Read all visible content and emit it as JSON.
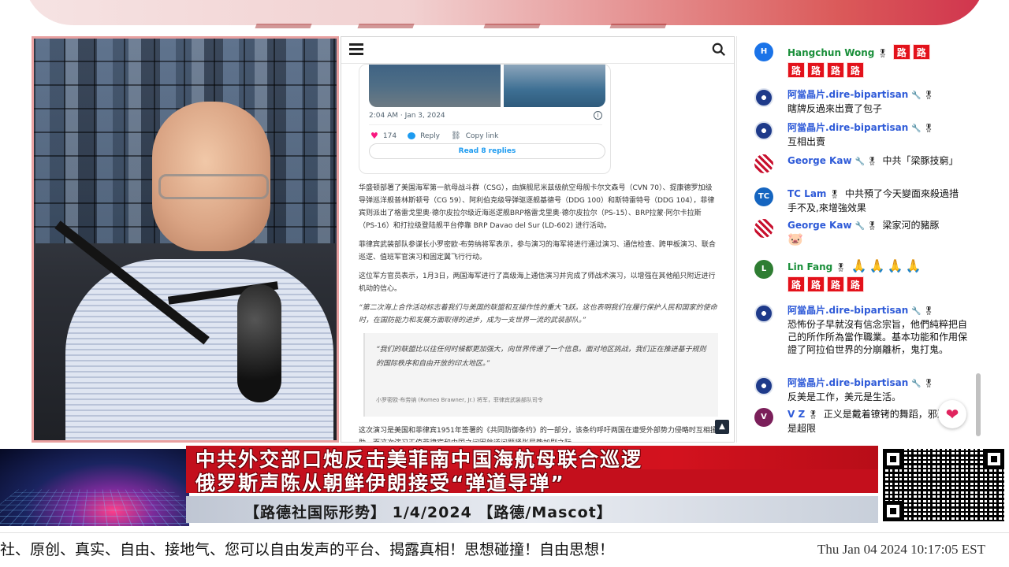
{
  "article": {
    "tweet": {
      "time": "2:04 AM · Jan 3, 2024",
      "likes": "174",
      "reply_label": "Reply",
      "copy_link_label": "Copy link",
      "read_replies_label": "Read 8 replies"
    },
    "paragraphs": [
      "华盛顿部署了美国海军第一航母战斗群（CSG），由旗舰尼米兹级航空母舰卡尔文森号（CVN 70）、提康德罗加级导弹巡洋舰普林斯顿号（CG 59）、阿利伯克级导弹驱逐舰基德号（DDG 100）和斯特雷特号（DDG 104），菲律宾则派出了格雷戈里奥·德尔皮拉尔级近海巡逻舰BRP格雷戈里奥·德尔皮拉尔（PS-15）、BRP拉蒙·阿尔卡拉斯（PS-16）和打拉级登陆舰平台停靠 BRP Davao del Sur (LD-602) 进行活动。",
      "菲律宾武装部队参谋长小罗密欧·布劳纳将军表示，参与演习的海军将进行通过演习、通信检查、跨甲板演习、联合巡逻、值班军官演习和固定翼飞行行动。",
      "这位军方官员表示，1月3日，两国海军进行了高级海上通信演习并完成了师战术演习，以增强在其他船只附近进行机动的信心。"
    ],
    "quote_paragraph": "“第二次海上合作活动标志着我们与美国的联盟和互操作性的重大飞跃。这也表明我们在履行保护人民和国家的使命时，在国防能力和发展方面取得的进步，成为一支世界一流的武装部队。”",
    "blockquote": {
      "text": "“我们的联盟比以往任何时候都更加强大，向世界传递了一个信息。面对地区挑战，我们正在推进基于规则的国际秩序和自由开放的印太地区。”",
      "credit": "小罗密欧·布劳纳 (Romeo Brawner, Jr.) 将军，菲律宾武装部队司令"
    },
    "closing_paragraph": "这次演习是美国和菲律宾1951年签署的《共同防御条约》的一部分，该条约呼吁两国在遭受外部势力侵略时互相援助，而这次演习正值菲律宾和中国之间因航道问题紧张局势加剧之际。"
  },
  "chat": {
    "messages": [
      {
        "author": "Hangchun Wong",
        "text": "",
        "lu_count": 6
      },
      {
        "author": "阿當晶片.dire-bipartisan",
        "text": "瞎牌反過來出賣了包子"
      },
      {
        "author": "阿當晶片.dire-bipartisan",
        "text": "互相出賣"
      },
      {
        "author": "George Kaw",
        "text": "中共「梁豚技窮」"
      },
      {
        "author": "TC Lam",
        "text": "中共預了今天變面來殺過措手不及,來增強效果"
      },
      {
        "author": "George Kaw",
        "text": "梁家河的豬豚"
      },
      {
        "author": "Lin Fang",
        "text": "",
        "lu_count": 4
      },
      {
        "author": "阿當晶片.dire-bipartisan",
        "text": "恐怖份子早就沒有信念宗旨，他們純粹把自己的所作所為當作職業。基本功能和作用保證了阿拉伯世界的分崩離析，鬼打鬼。"
      },
      {
        "author": "阿當晶片.dire-bipartisan",
        "text": "反美是工作，美元是生活。"
      },
      {
        "author": "V Z",
        "text": "正义是戴着镣铐的舞蹈，邪恶靠的是超限"
      }
    ],
    "avatars": {
      "h": "H",
      "tc": "TC",
      "l": "L",
      "v": "V"
    },
    "lu_char": "路"
  },
  "lower_third": {
    "headline_1": "中共外交部口炮反击美菲南中国海航母联合巡逻",
    "headline_2": "俄罗斯声陈从朝鲜伊朗接受“弹道导弹”",
    "show_title": "【路德社国际形势】 1/4/2024 【路德/Mascot】"
  },
  "ticker": {
    "text": "社、原创、真实、自由、接地气、您可以自由发声的平台、揭露真相！思想碰撞！自由思想！",
    "clock": "Thu Jan 04 2024 10:17:05 EST"
  },
  "colors": {
    "chat_author_green": "#1a8f3a",
    "headline_red": "#c40f1c",
    "lu_badge": "#e3121b"
  }
}
